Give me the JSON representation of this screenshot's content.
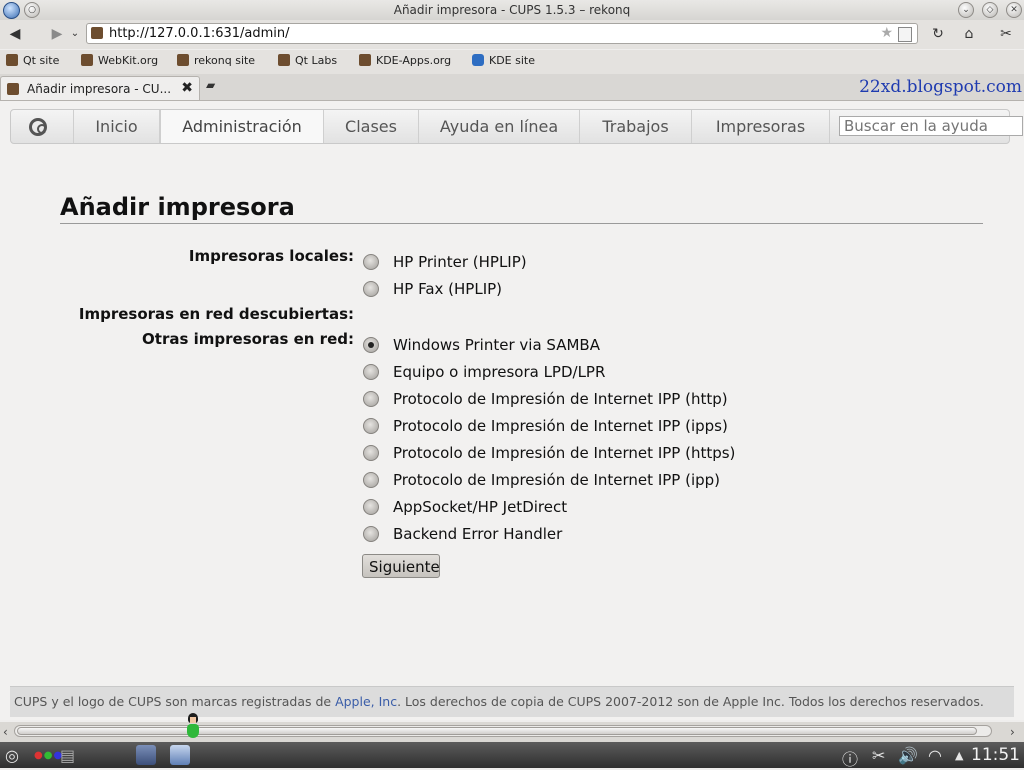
{
  "window": {
    "title": "Añadir impresora - CUPS 1.5.3 – rekonq",
    "url": "http://127.0.0.1:631/admin/"
  },
  "bookmarks": [
    "Qt site",
    "WebKit.org",
    "rekonq site",
    "Qt Labs",
    "KDE-Apps.org",
    "KDE site"
  ],
  "tab": {
    "label": "Añadir impresora - CU..."
  },
  "watermark": "22xd.blogspot.com",
  "cups_nav": {
    "items": [
      "Inicio",
      "Administración",
      "Clases",
      "Ayuda en línea",
      "Trabajos",
      "Impresoras"
    ],
    "active": "Administración",
    "search_placeholder": "Buscar en la ayuda"
  },
  "page": {
    "title": "Añadir impresora",
    "labels": {
      "local": "Impresoras locales:",
      "discovered": "Impresoras en red descubiertas:",
      "other": "Otras impresoras en red:"
    },
    "local_options": [
      "HP Printer (HPLIP)",
      "HP Fax (HPLIP)"
    ],
    "other_options": [
      "Windows Printer via SAMBA",
      "Equipo o impresora LPD/LPR",
      "Protocolo de Impresión de Internet IPP (http)",
      "Protocolo de Impresión de Internet IPP (ipps)",
      "Protocolo de Impresión de Internet IPP (https)",
      "Protocolo de Impresión de Internet IPP (ipp)",
      "AppSocket/HP JetDirect",
      "Backend Error Handler"
    ],
    "selected": "Windows Printer via SAMBA",
    "submit_label": "Siguiente"
  },
  "footer": {
    "before": "CUPS y el logo de CUPS son marcas registradas de ",
    "link": "Apple, Inc",
    "after": ". Los derechos de copia de CUPS 2007-2012 son de Apple Inc. Todos los derechos reservados."
  },
  "taskbar": {
    "clock": "11:51"
  }
}
